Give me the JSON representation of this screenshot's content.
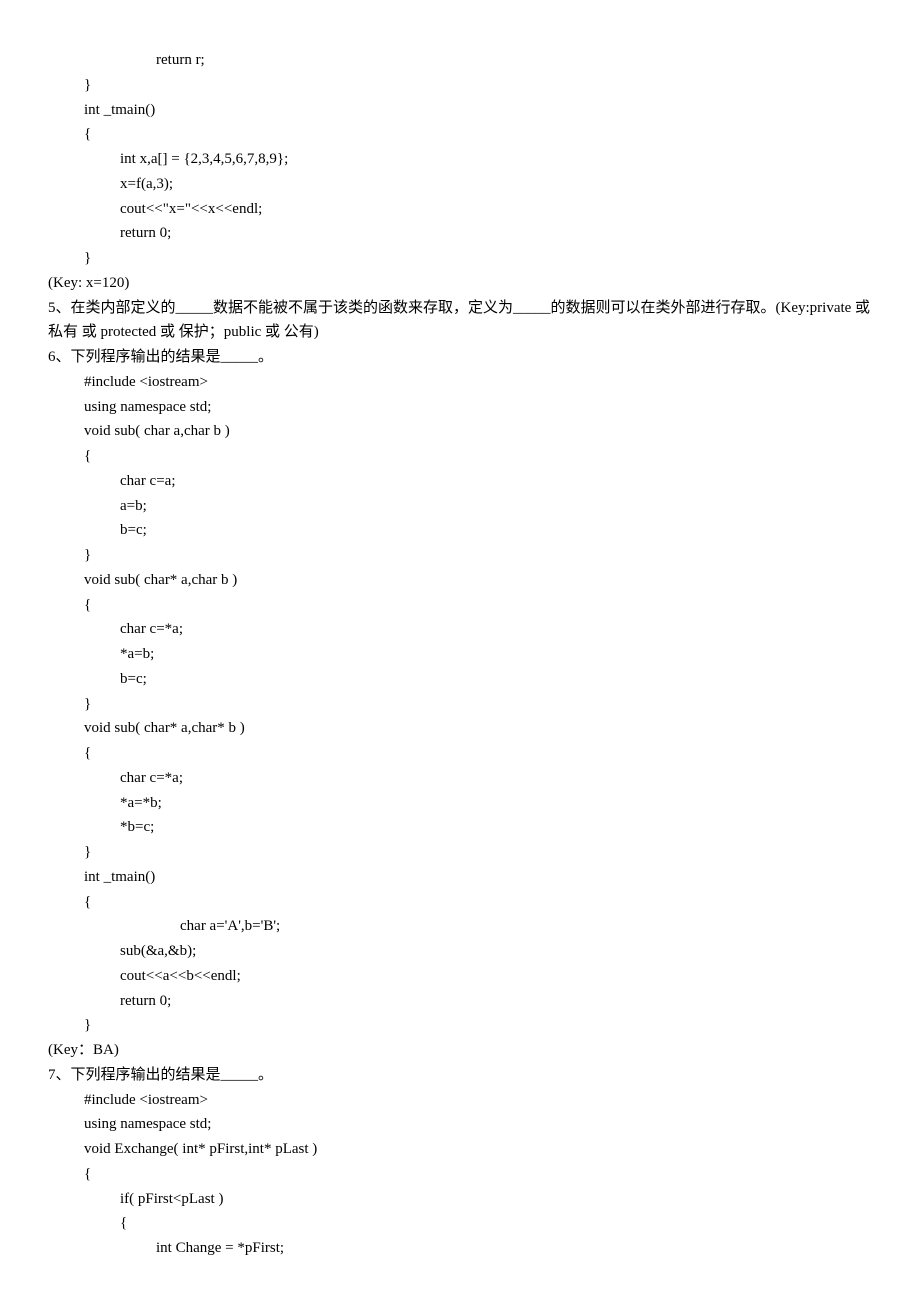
{
  "code4_cont": {
    "line1": "return r;",
    "line2": "}",
    "line3": "int _tmain()",
    "line4": "{",
    "line5": "int x,a[] = {2,3,4,5,6,7,8,9};",
    "line6": "x=f(a,3);",
    "line7": "cout<<\"x=\"<<x<<endl;",
    "line8": "return 0;",
    "line9": "}"
  },
  "key4": "(Key: x=120)",
  "q5": "5、在类内部定义的_____数据不能被不属于该类的函数来存取，定义为_____的数据则可以在类外部进行存取。(Key:private 或 私有 或 protected 或 保护；public  或  公有)",
  "q6": "6、下列程序输出的结果是_____。",
  "code6": {
    "line1": "#include <iostream>",
    "line2": "using namespace std;",
    "line3": "void sub( char a,char b )",
    "line4": "{",
    "line5": "char c=a;",
    "line6": "a=b;",
    "line7": "b=c;",
    "line8": "}",
    "line9": "void sub( char* a,char b )",
    "line10": "{",
    "line11": "char c=*a;",
    "line12": "*a=b;",
    "line13": "b=c;",
    "line14": "}",
    "line15": "void sub( char* a,char* b )",
    "line16": "{",
    "line17": "char c=*a;",
    "line18": "*a=*b;",
    "line19": "*b=c;",
    "line20": "}",
    "line21": "int _tmain()",
    "line22": "{",
    "line23": "char a='A',b='B';",
    "line24": "sub(&a,&b);",
    "line25": "cout<<a<<b<<endl;",
    "line26": "return 0;",
    "line27": "}"
  },
  "key6": "(Key：BA)",
  "q7": "7、下列程序输出的结果是_____。",
  "code7": {
    "line1": "#include <iostream>",
    "line2": "using namespace std;",
    "line3": "void Exchange( int* pFirst,int* pLast )",
    "line4": "{",
    "line5": "if( pFirst<pLast )",
    "line6": "{",
    "line7": "int Change = *pFirst;"
  }
}
